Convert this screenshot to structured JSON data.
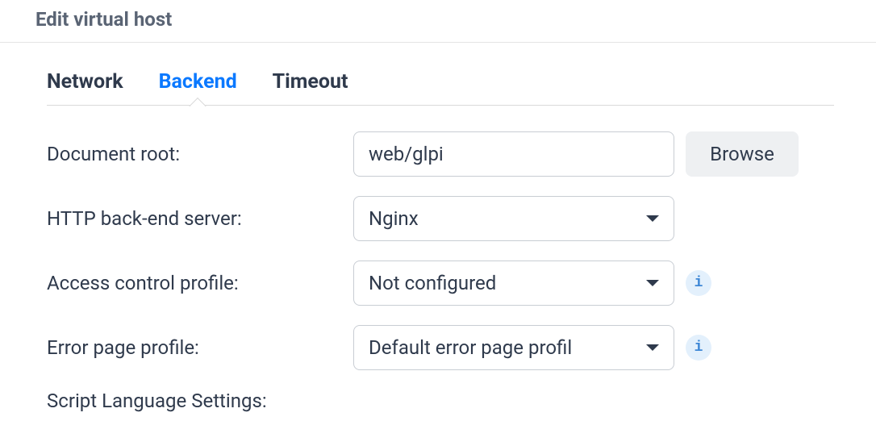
{
  "header": {
    "title": "Edit virtual host"
  },
  "tabs": {
    "network": "Network",
    "backend": "Backend",
    "timeout": "Timeout",
    "active": "backend"
  },
  "form": {
    "document_root": {
      "label": "Document root:",
      "value": "web/glpi",
      "browse_label": "Browse"
    },
    "http_backend": {
      "label": "HTTP back-end server:",
      "value": "Nginx"
    },
    "access_control": {
      "label": "Access control profile:",
      "value": "Not configured"
    },
    "error_page": {
      "label": "Error page profile:",
      "value": "Default error page profil"
    },
    "script_lang": {
      "label": "Script Language Settings:"
    }
  },
  "icons": {
    "info_glyph": "i"
  }
}
